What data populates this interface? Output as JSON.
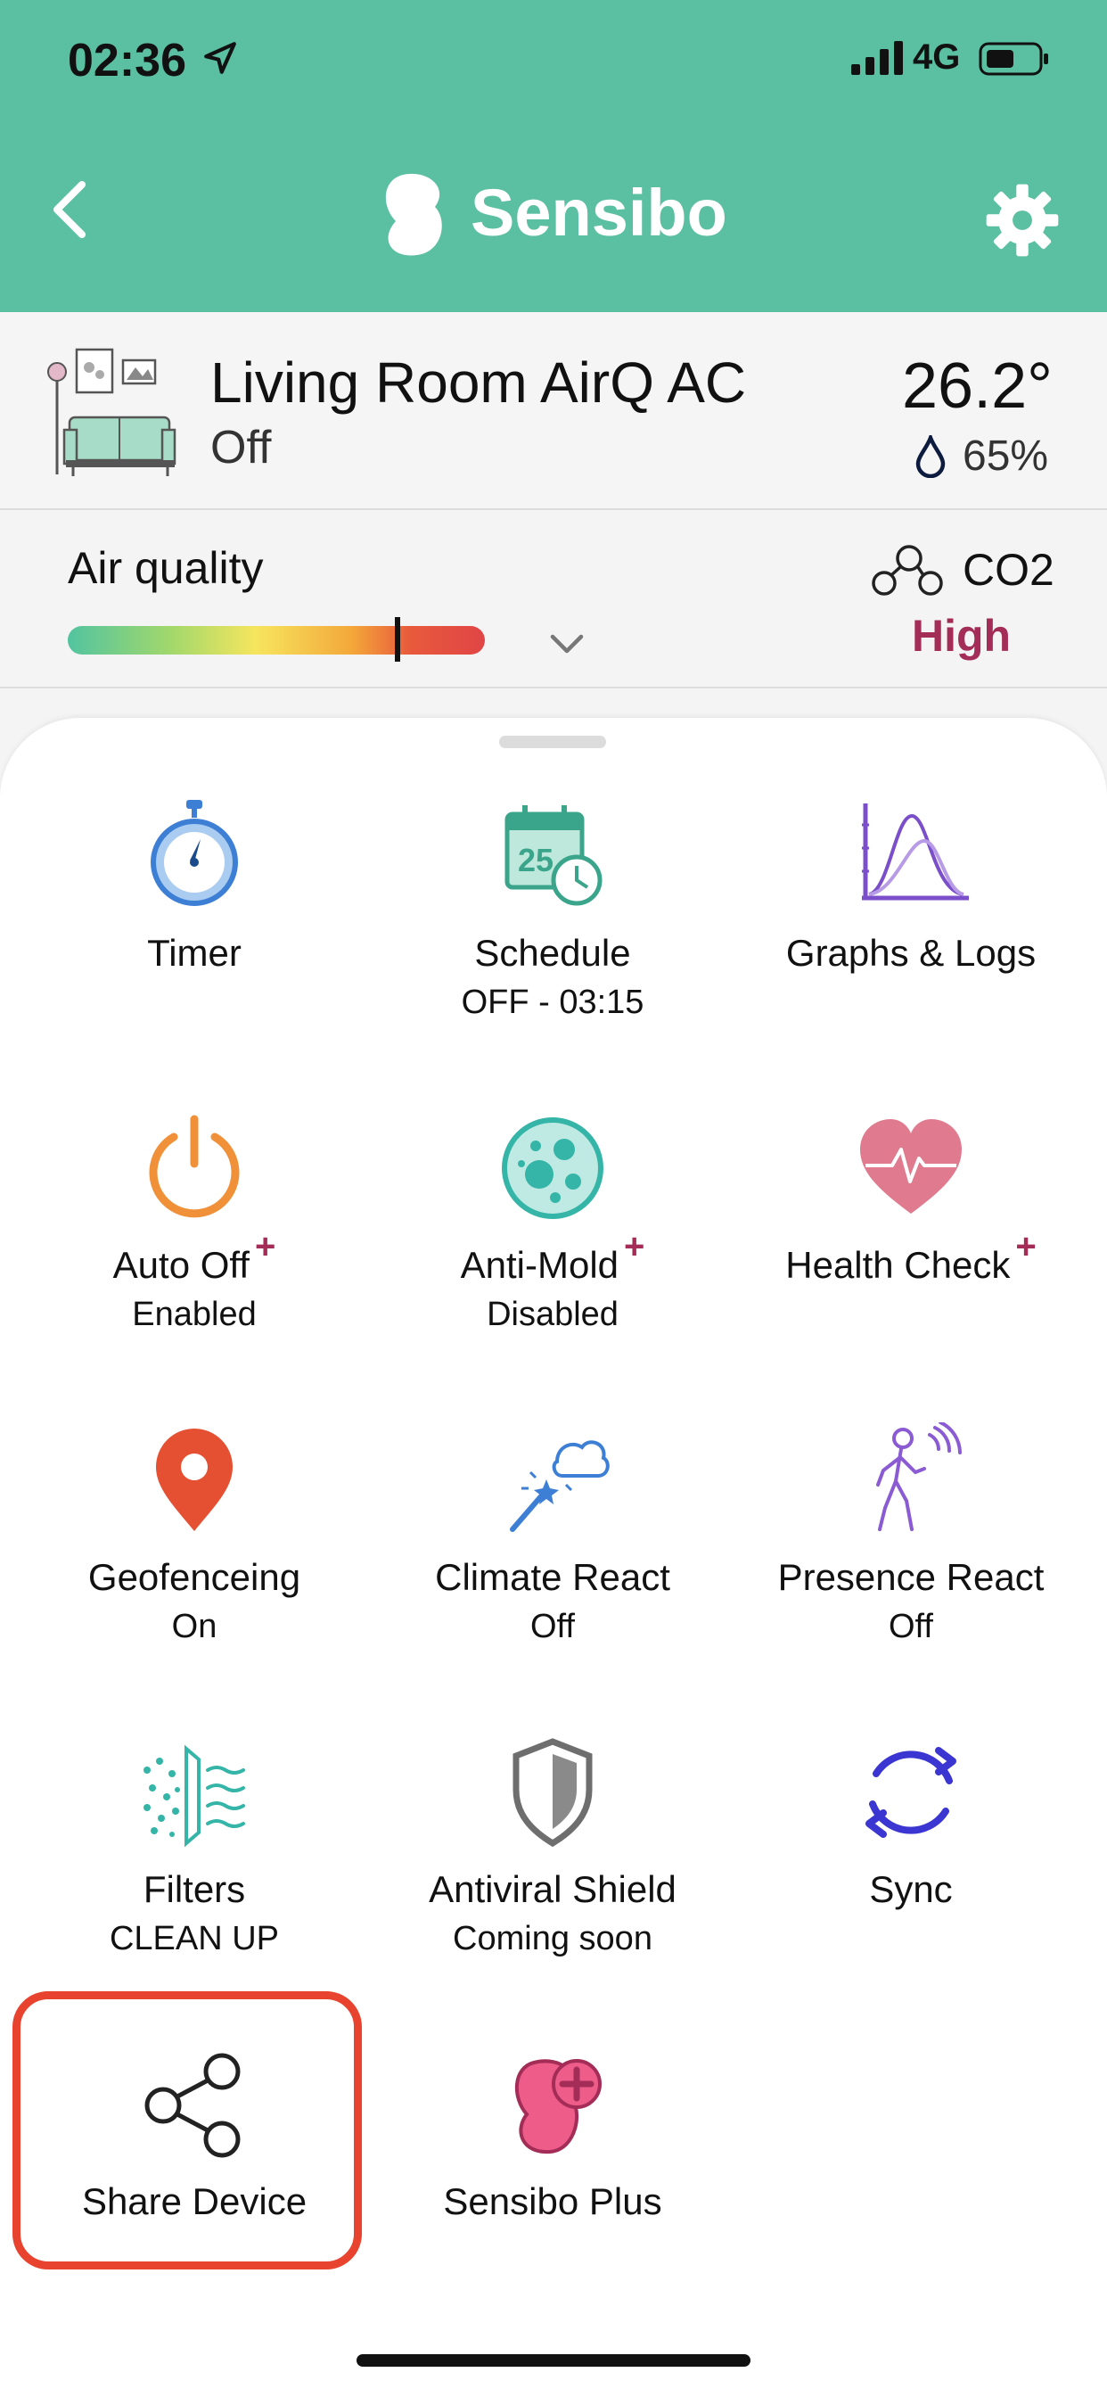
{
  "status_bar": {
    "time": "02:36",
    "network": "4G"
  },
  "header": {
    "title": "Sensibo"
  },
  "device": {
    "name": "Living Room AirQ AC",
    "state": "Off",
    "temperature": "26.2°",
    "humidity": "65%"
  },
  "air_quality": {
    "label": "Air quality",
    "level_fraction": 0.79,
    "pollutant": "CO2",
    "level_text": "High"
  },
  "features": [
    {
      "label": "Timer",
      "sub": "",
      "icon": "stopwatch-icon",
      "plus": false
    },
    {
      "label": "Schedule",
      "sub": "OFF - 03:15",
      "icon": "calendar-clock-icon",
      "plus": false
    },
    {
      "label": "Graphs & Logs",
      "sub": "",
      "icon": "graph-icon",
      "plus": false
    },
    {
      "label": "Auto Off",
      "sub": "Enabled",
      "icon": "power-icon",
      "plus": true
    },
    {
      "label": "Anti-Mold",
      "sub": "Disabled",
      "icon": "mold-icon",
      "plus": true
    },
    {
      "label": "Health Check",
      "sub": "",
      "icon": "heart-pulse-icon",
      "plus": true
    },
    {
      "label": "Geofenceing",
      "sub": "On",
      "icon": "location-pin-icon",
      "plus": false
    },
    {
      "label": "Climate React",
      "sub": "Off",
      "icon": "magic-wand-cloud-icon",
      "plus": false
    },
    {
      "label": "Presence React",
      "sub": "Off",
      "icon": "walking-person-icon",
      "plus": false
    },
    {
      "label": "Filters",
      "sub": "CLEAN UP",
      "icon": "filter-icon",
      "plus": false
    },
    {
      "label": "Antiviral Shield",
      "sub": "Coming soon",
      "icon": "shield-icon",
      "plus": false
    },
    {
      "label": "Sync",
      "sub": "",
      "icon": "sync-icon",
      "plus": false
    },
    {
      "label": "Share Device",
      "sub": "",
      "icon": "share-icon",
      "plus": false
    },
    {
      "label": "Sensibo Plus",
      "sub": "",
      "icon": "sensibo-plus-icon",
      "plus": false
    }
  ],
  "plus_mark": "+",
  "colors": {
    "header": "#5bbfa1",
    "accent_red": "#a32d56",
    "highlight": "#e8432e"
  }
}
